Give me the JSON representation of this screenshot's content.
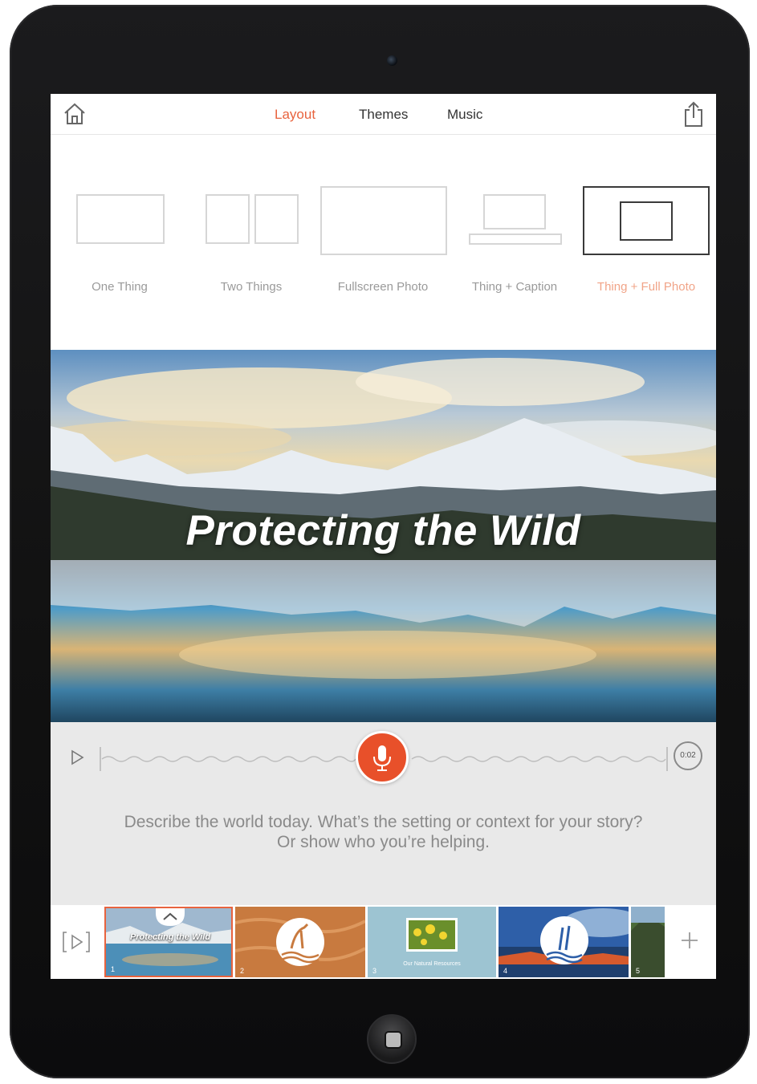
{
  "toolbar": {
    "tabs": [
      {
        "label": "Layout",
        "active": true
      },
      {
        "label": "Themes",
        "active": false
      },
      {
        "label": "Music",
        "active": false
      }
    ],
    "home_icon": "home-icon",
    "share_icon": "share-icon"
  },
  "layouts": [
    {
      "label": "One Thing",
      "selected": false
    },
    {
      "label": "Two Things",
      "selected": false
    },
    {
      "label": "Fullscreen Photo",
      "selected": false
    },
    {
      "label": "Thing + Caption",
      "selected": false
    },
    {
      "label": "Thing + Full Photo",
      "selected": true
    }
  ],
  "hero": {
    "title": "Protecting the Wild"
  },
  "recorder": {
    "timer": "0:02",
    "prompt_line1": "Describe the world today. What’s the setting or context for your story?",
    "prompt_line2": "Or show who you’re helping."
  },
  "filmstrip": {
    "thumbs": [
      {
        "number": "1",
        "caption": "Protecting the Wild"
      },
      {
        "number": "2"
      },
      {
        "number": "3",
        "caption": "Our Natural Resources"
      },
      {
        "number": "4"
      },
      {
        "number": "5"
      }
    ]
  },
  "colors": {
    "accent": "#e8633e",
    "mic": "#e8502a",
    "recorder_bg": "#e9e9e9"
  }
}
